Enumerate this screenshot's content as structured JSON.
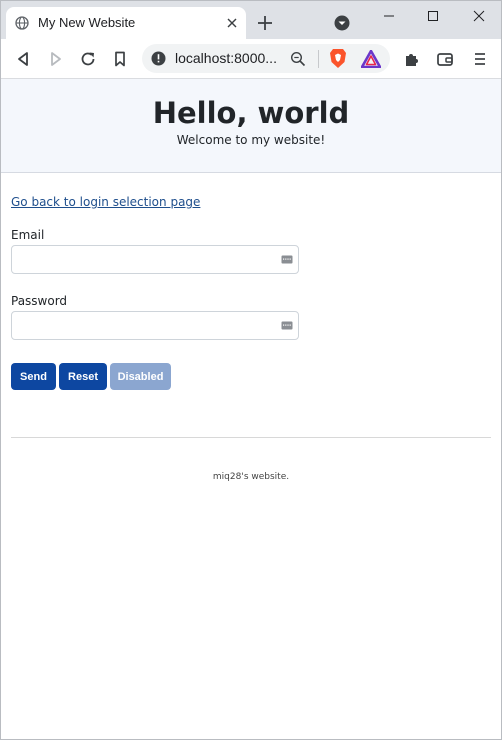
{
  "browser": {
    "tab_title": "My New Website",
    "address": "localhost:8000...",
    "icons": [
      "globe-icon",
      "close-icon",
      "plus-icon",
      "chevron-down-icon",
      "minimize-icon",
      "maximize-icon",
      "window-close-icon",
      "back-icon",
      "forward-icon",
      "reload-icon",
      "bookmark-icon",
      "info-icon",
      "zoom-icon",
      "brave-shield-icon",
      "brave-rewards-icon",
      "extensions-icon",
      "wallet-icon",
      "menu-icon"
    ]
  },
  "header": {
    "title": "Hello, world",
    "subtitle": "Welcome to my website!"
  },
  "main": {
    "back_link": "Go back to login selection page",
    "email_label": "Email",
    "email_value": "",
    "password_label": "Password",
    "password_value": "",
    "buttons": {
      "send": "Send",
      "reset": "Reset",
      "disabled": "Disabled"
    }
  },
  "footer": {
    "text": "miq28's website."
  },
  "colors": {
    "primary": "#0d47a1",
    "disabled": "#8ba6d0",
    "header_bg": "#f4f7fc",
    "link": "#1e4e8c"
  }
}
